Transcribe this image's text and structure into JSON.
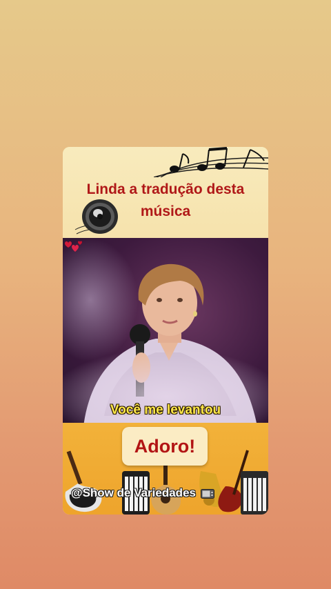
{
  "post": {
    "title_line1": "Linda a tradução desta",
    "title_line2": "música",
    "subtitle": "Você me levantou",
    "reaction_label": "Adoro!",
    "handle": "@Show de Variedades"
  },
  "icons": [
    "speaker-icon",
    "music-notes-icon",
    "hearts-icon",
    "tv-icon"
  ],
  "colors": {
    "title": "#b01818",
    "subtitle": "#ffe94a",
    "header_bg": "#f7e7b6",
    "footer_bg": "#eea42c"
  }
}
